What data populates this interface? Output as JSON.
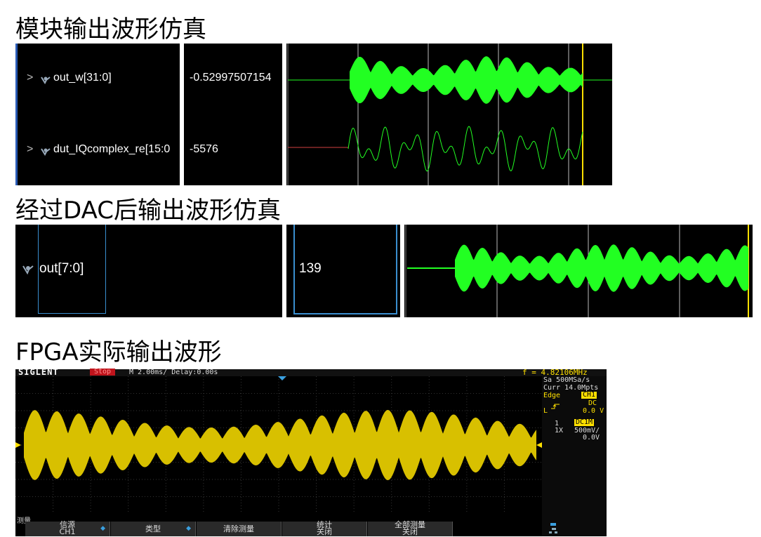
{
  "sections": {
    "sim1_title": "模块输出波形仿真",
    "sim2_title": "经过DAC后输出波形仿真",
    "fpga_title": "FPGA实际输出波形"
  },
  "sim1": {
    "signals": [
      {
        "name": "out_w[31:0]",
        "value": "-0.52997507154"
      },
      {
        "name": "dut_IQcomplex_re[15:0",
        "value": "-5576"
      }
    ],
    "expand_glyph": ">"
  },
  "sim2": {
    "signals": [
      {
        "name": "out[7:0]",
        "value": "139"
      }
    ]
  },
  "scope": {
    "brand": "SIGLENT",
    "run_state": "Stop",
    "timebase": "M 2.00ms/ Delay:0.00s",
    "frequency": "f = 4.82106MHz",
    "sample_rate": "Sa 500MSa/s",
    "memory": "Curr 14.0Mpts",
    "trigger_type": "Edge",
    "trigger_source": "CH1",
    "trigger_coupling": "DC",
    "trigger_level_label": "L",
    "trigger_level": "0.0 V",
    "ch_number": "1",
    "ch_coupling": "DC1M",
    "probe": "1X",
    "vdiv": "500mV/",
    "offset": "0.0V",
    "ch_marker": "1",
    "menu_title": "测量",
    "softkeys": [
      {
        "line1": "信源",
        "line2": "CH1"
      },
      {
        "line1": "类型",
        "line2": ""
      },
      {
        "line1": "清除测量",
        "line2": ""
      },
      {
        "line1": "统计",
        "line2": "关闭"
      },
      {
        "line1": "全部测量",
        "line2": "关闭"
      }
    ],
    "colors": {
      "trace": "#d8c000",
      "accent_red": "#c0141c",
      "trigger_yellow": "#ffe000",
      "sim_green": "#22ff22"
    }
  }
}
